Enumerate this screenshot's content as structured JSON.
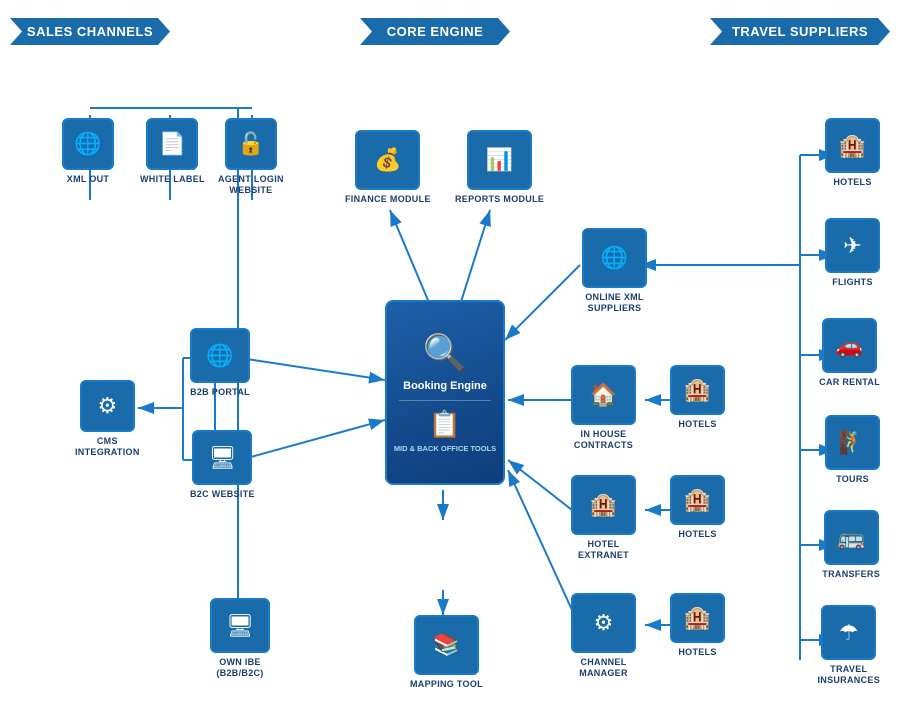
{
  "banners": {
    "left": "SALES CHANNELS",
    "center": "CORE ENGINE",
    "right": "TRAVEL SUPPLIERS"
  },
  "sales_channels": {
    "xml_out": {
      "label": "XML OUT",
      "icon": "🌐"
    },
    "white_label": {
      "label": "WHITE LABEL",
      "icon": "📄"
    },
    "agent_login": {
      "label": "AGENT LOGIN\nWEBSITE",
      "icon": "🔓"
    },
    "b2b_portal": {
      "label": "B2B PORTAL",
      "icon": "🌐"
    },
    "b2c_website": {
      "label": "B2C WEBSITE",
      "icon": "🖥"
    },
    "cms_integration": {
      "label": "CMS\nINTEGRATION",
      "icon": "⚙"
    },
    "own_ibe": {
      "label": "OWN IBE\n(B2B/B2C)",
      "icon": "🖥"
    }
  },
  "core_engine": {
    "finance_module": {
      "label": "FINANCE MODULE",
      "icon": "💰"
    },
    "reports_module": {
      "label": "REPORTS MODULE",
      "icon": "📊"
    },
    "booking_engine": {
      "label": "Booking Engine",
      "icon": "🔍"
    },
    "mid_back_office": {
      "label": "MID & BACK OFFICE TOOLS",
      "icon": "📋"
    },
    "mapping_tool": {
      "label": "MAPPING TOOL",
      "icon": "📚"
    }
  },
  "middle": {
    "online_xml": {
      "label": "ONLINE XML\nSUPPLIERS",
      "icon": "🌐"
    },
    "in_house": {
      "label": "IN HOUSE\nCONTRACTS",
      "icon": "🏠"
    },
    "hotel_extranet": {
      "label": "HOTEL\nEXTRANET",
      "icon": "🏨"
    },
    "channel_manager": {
      "label": "CHANNEL\nMANAGER",
      "icon": "⚙"
    }
  },
  "suppliers": {
    "hotels1": {
      "label": "HOTELS",
      "icon": "🏨"
    },
    "flights": {
      "label": "FLIGHTS",
      "icon": "✈"
    },
    "car_rental": {
      "label": "CAR RENTAL",
      "icon": "🚗"
    },
    "tours": {
      "label": "TOURS",
      "icon": "🧗"
    },
    "transfers": {
      "label": "TRANSFERS",
      "icon": "🚌"
    },
    "travel_insurances": {
      "label": "TRAVEL\nINSURANCES",
      "icon": "☂"
    }
  },
  "hotels_icons": {
    "h1": "HOTELS",
    "h2": "HOTELS",
    "h3": "HOTELS"
  }
}
